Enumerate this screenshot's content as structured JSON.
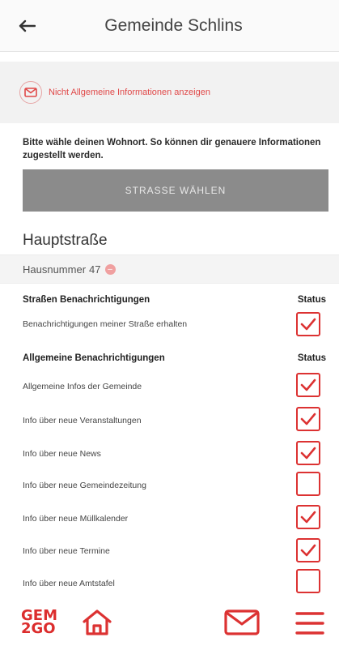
{
  "header": {
    "title": "Gemeinde Schlins",
    "back_icon": "arrow-left-icon"
  },
  "info": {
    "link_text": "Nicht Allgemeine Informationen anzeigen"
  },
  "hint": "Bitte wähle deinen Wohnort. So können dir genauere Informationen zugestellt werden.",
  "select_button": "STRASSE WÄHLEN",
  "street": "Hauptstraße",
  "house": {
    "label": "Hausnummer",
    "number": "47"
  },
  "sections": [
    {
      "title": "Straßen Benachrichtigungen",
      "status_label": "Status",
      "items": [
        {
          "label": "Benachrichtigungen meiner Straße erhalten",
          "checked": true
        }
      ]
    },
    {
      "title": "Allgemeine Benachrichtigungen",
      "status_label": "Status",
      "items": [
        {
          "label": "Allgemeine Infos der Gemeinde",
          "checked": true
        },
        {
          "label": "Info über neue Veranstaltungen",
          "checked": true
        },
        {
          "label": "Info über neue News",
          "checked": true
        },
        {
          "label": "Info über neue Gemeindezeitung",
          "checked": false
        },
        {
          "label": "Info über neue Müllkalender",
          "checked": true
        },
        {
          "label": "Info über neue Termine",
          "checked": true
        },
        {
          "label": "Info über neue Amtstafel",
          "checked": false
        }
      ]
    }
  ],
  "bottom_nav": {
    "logo_line1": "GEM",
    "logo_line2": "2GO",
    "icons": [
      "home-icon",
      "mail-icon",
      "menu-icon"
    ]
  },
  "colors": {
    "accent": "#dc3232",
    "button_gray": "#8b8b8b",
    "header_bg": "#fafafa"
  }
}
